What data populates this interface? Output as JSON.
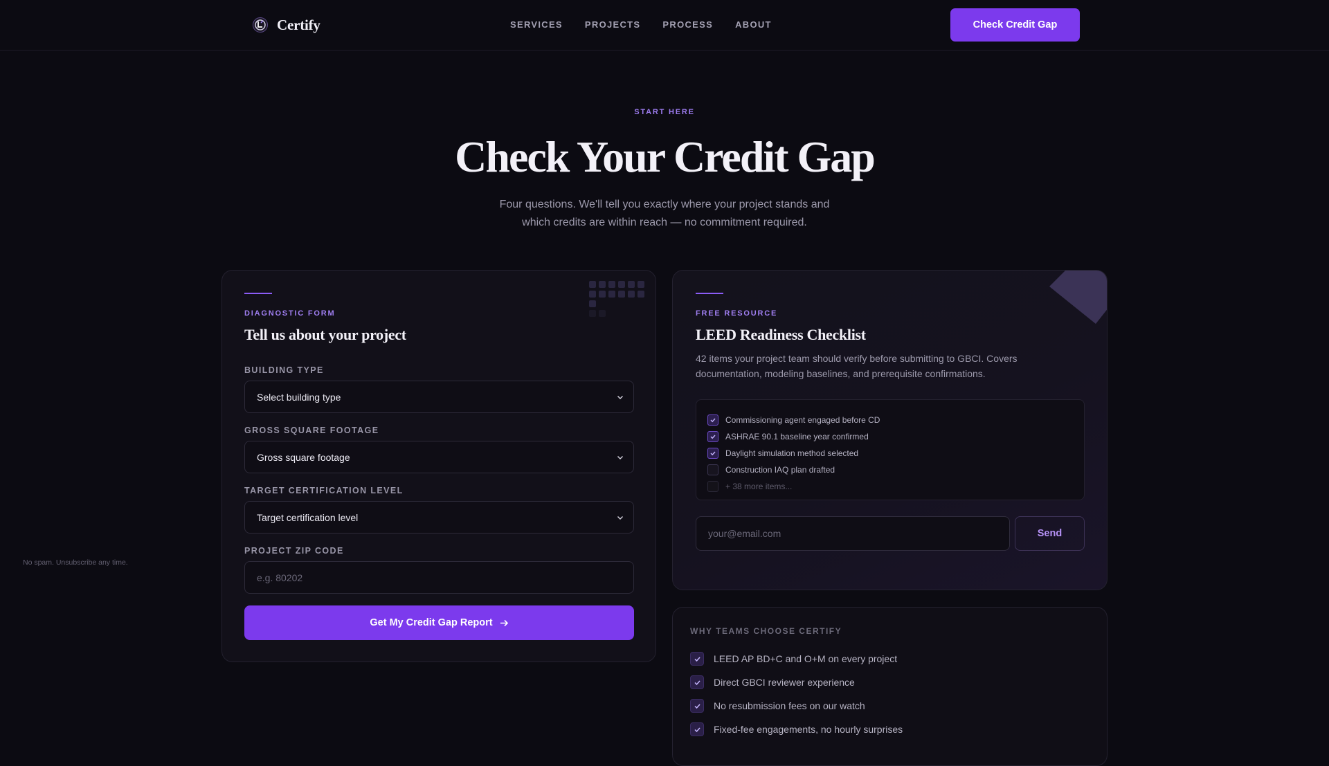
{
  "brand": {
    "name": "Certify",
    "logo_icon": "compass-logo-icon"
  },
  "nav": {
    "links": [
      "SERVICES",
      "PROJECTS",
      "PROCESS",
      "ABOUT"
    ],
    "cta": "Check Credit Gap"
  },
  "hero": {
    "eyebrow": "START HERE",
    "title": "Check Your Credit Gap",
    "subtitle_line1": "Four questions. We'll tell you exactly where your project stands and",
    "subtitle_line2": "which credits are within reach — no commitment required."
  },
  "form": {
    "eyebrow": "DIAGNOSTIC FORM",
    "title": "Tell us about your project",
    "fields": {
      "building_type": {
        "label": "BUILDING TYPE",
        "value": "Select building type"
      },
      "square_footage": {
        "label": "GROSS SQUARE FOOTAGE",
        "value": "Gross square footage"
      },
      "cert_level": {
        "label": "TARGET CERTIFICATION LEVEL",
        "value": "Target certification level"
      },
      "zip": {
        "label": "PROJECT ZIP CODE",
        "placeholder": "e.g. 80202",
        "value": ""
      }
    },
    "submit": "Get My Credit Gap Report"
  },
  "resource": {
    "eyebrow": "FREE RESOURCE",
    "title": "LEED Readiness Checklist",
    "desc_line1": "42 items your project team should verify before submitting to GBCI. Covers",
    "desc_line2": "documentation, modeling baselines, and prerequisite confirmations.",
    "items": [
      {
        "text": "Commissioning agent engaged before CD",
        "checked": true
      },
      {
        "text": "ASHRAE 90.1 baseline year confirmed",
        "checked": true
      },
      {
        "text": "Daylight simulation method selected",
        "checked": true
      },
      {
        "text": "Construction IAQ plan drafted",
        "checked": false
      },
      {
        "text": "+ 38 more items...",
        "checked": false
      }
    ],
    "email_placeholder": "your@email.com",
    "send": "Send",
    "footnote": "No spam. Unsubscribe any time."
  },
  "why": {
    "eyebrow": "WHY TEAMS CHOOSE CERTIFY",
    "items": [
      "LEED AP BD+C and O+M on every project",
      "Direct GBCI reviewer experience",
      "No resubmission fees on our watch",
      "Fixed-fee engagements, no hourly surprises"
    ]
  },
  "colors": {
    "accent": "#7c3aed",
    "background": "#0c0b12",
    "accent_text": "#a07ff2"
  }
}
